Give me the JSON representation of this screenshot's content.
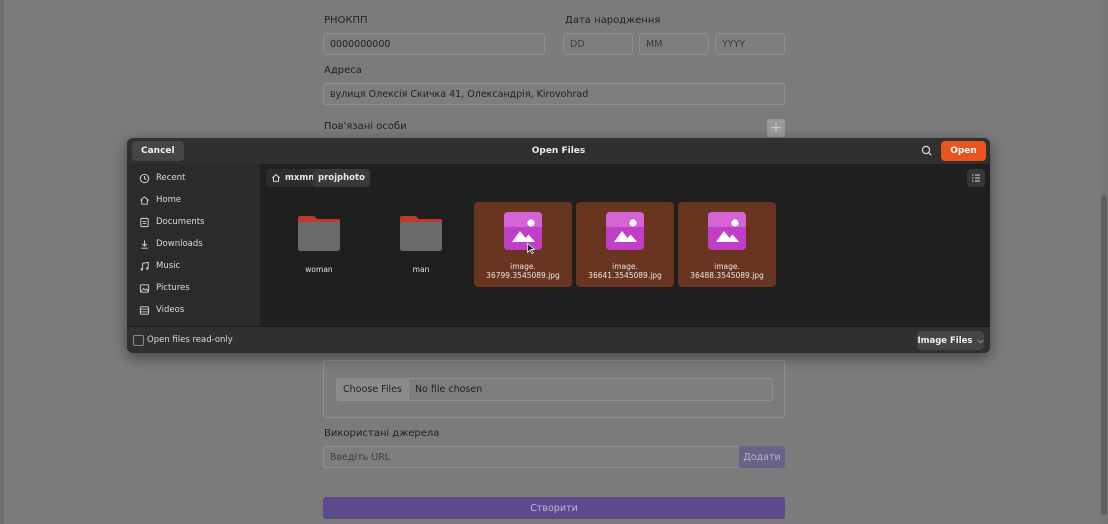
{
  "form": {
    "rnokpp_label": "РНОКПП",
    "rnokpp_value": "0000000000",
    "birth_label": "Дата народження",
    "dd_placeholder": "DD",
    "mm_placeholder": "MM",
    "yyyy_placeholder": "YYYY",
    "address_label": "Адреса",
    "address_value": "вулиця Олексія Скичка 41, Олександрія, Kirovohrad",
    "related_label": "Пов'язані особи",
    "plus": "+",
    "choose_files": "Choose Files",
    "no_file": "No file chosen",
    "sources_label": "Використані джерела",
    "url_placeholder": "Введіть URL",
    "add_button": "Додати",
    "create_button": "Створити"
  },
  "dialog": {
    "title": "Open Files",
    "cancel": "Cancel",
    "open": "Open",
    "sidebar": [
      {
        "label": "Recent",
        "icon": "clock-icon"
      },
      {
        "label": "Home",
        "icon": "home-icon"
      },
      {
        "label": "Documents",
        "icon": "document-icon"
      },
      {
        "label": "Downloads",
        "icon": "download-icon"
      },
      {
        "label": "Music",
        "icon": "music-icon"
      },
      {
        "label": "Pictures",
        "icon": "picture-icon"
      },
      {
        "label": "Videos",
        "icon": "video-icon"
      }
    ],
    "breadcrumb": [
      "mxmn",
      "projphoto"
    ],
    "items": [
      {
        "type": "folder",
        "name": "woman",
        "selected": false
      },
      {
        "type": "folder",
        "name": "man",
        "selected": false
      },
      {
        "type": "image",
        "name_line1": "image.",
        "name_line2": "36799.3545089.jpg",
        "selected": true
      },
      {
        "type": "image",
        "name_line1": "image.",
        "name_line2": "36641.3545089.jpg",
        "selected": true
      },
      {
        "type": "image",
        "name_line1": "image.",
        "name_line2": "36488.3545089.jpg",
        "selected": true
      }
    ],
    "read_only_label": "Open files read-only",
    "filter_label": "Image Files"
  },
  "colors": {
    "accent": "#e95420",
    "selection": "#6a3520",
    "folder_tab": "#c0392b",
    "image_icon": "#c13fc4",
    "create_button": "#5c4b8c"
  }
}
